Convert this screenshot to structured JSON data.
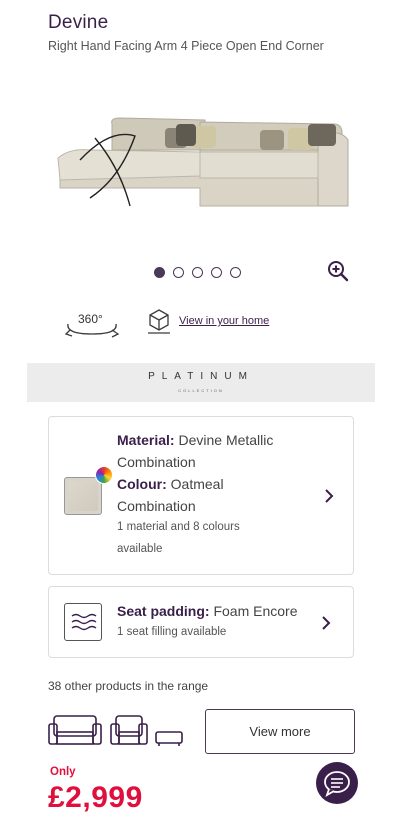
{
  "product": {
    "title": "Devine",
    "subtitle": "Right Hand Facing Arm 4 Piece Open End Corner"
  },
  "gallery": {
    "slide_count": 5,
    "active_slide": 1
  },
  "viewer": {
    "label_360": "360°",
    "ar_link": "View in your home"
  },
  "collection": {
    "name": "PLATINUM",
    "sub": "COLLECTION"
  },
  "material_card": {
    "material_label": "Material:",
    "material_value": "Devine Metallic",
    "material_value_2": "Combination",
    "colour_label": "Colour:",
    "colour_value": "Oatmeal",
    "colour_value_2": "Combination",
    "availability_1": "1 material and 8 colours",
    "availability_2": "available"
  },
  "padding_card": {
    "label": "Seat padding:",
    "value": "Foam Encore",
    "availability": "1 seat filling available"
  },
  "range": {
    "text": "38 other products in the range",
    "view_more": "View more"
  },
  "pricing": {
    "prefix": "Only",
    "price": "£2,999"
  },
  "colors": {
    "brand_purple": "#3a1f4a",
    "price_red": "#e0103e"
  },
  "icons": [
    "zoom-in-icon",
    "rotate-360-icon",
    "ar-cube-icon",
    "colour-wheel-icon",
    "waves-icon",
    "chevron-right-icon",
    "sofa-icon",
    "armchair-icon",
    "footstool-icon",
    "chat-icon"
  ]
}
